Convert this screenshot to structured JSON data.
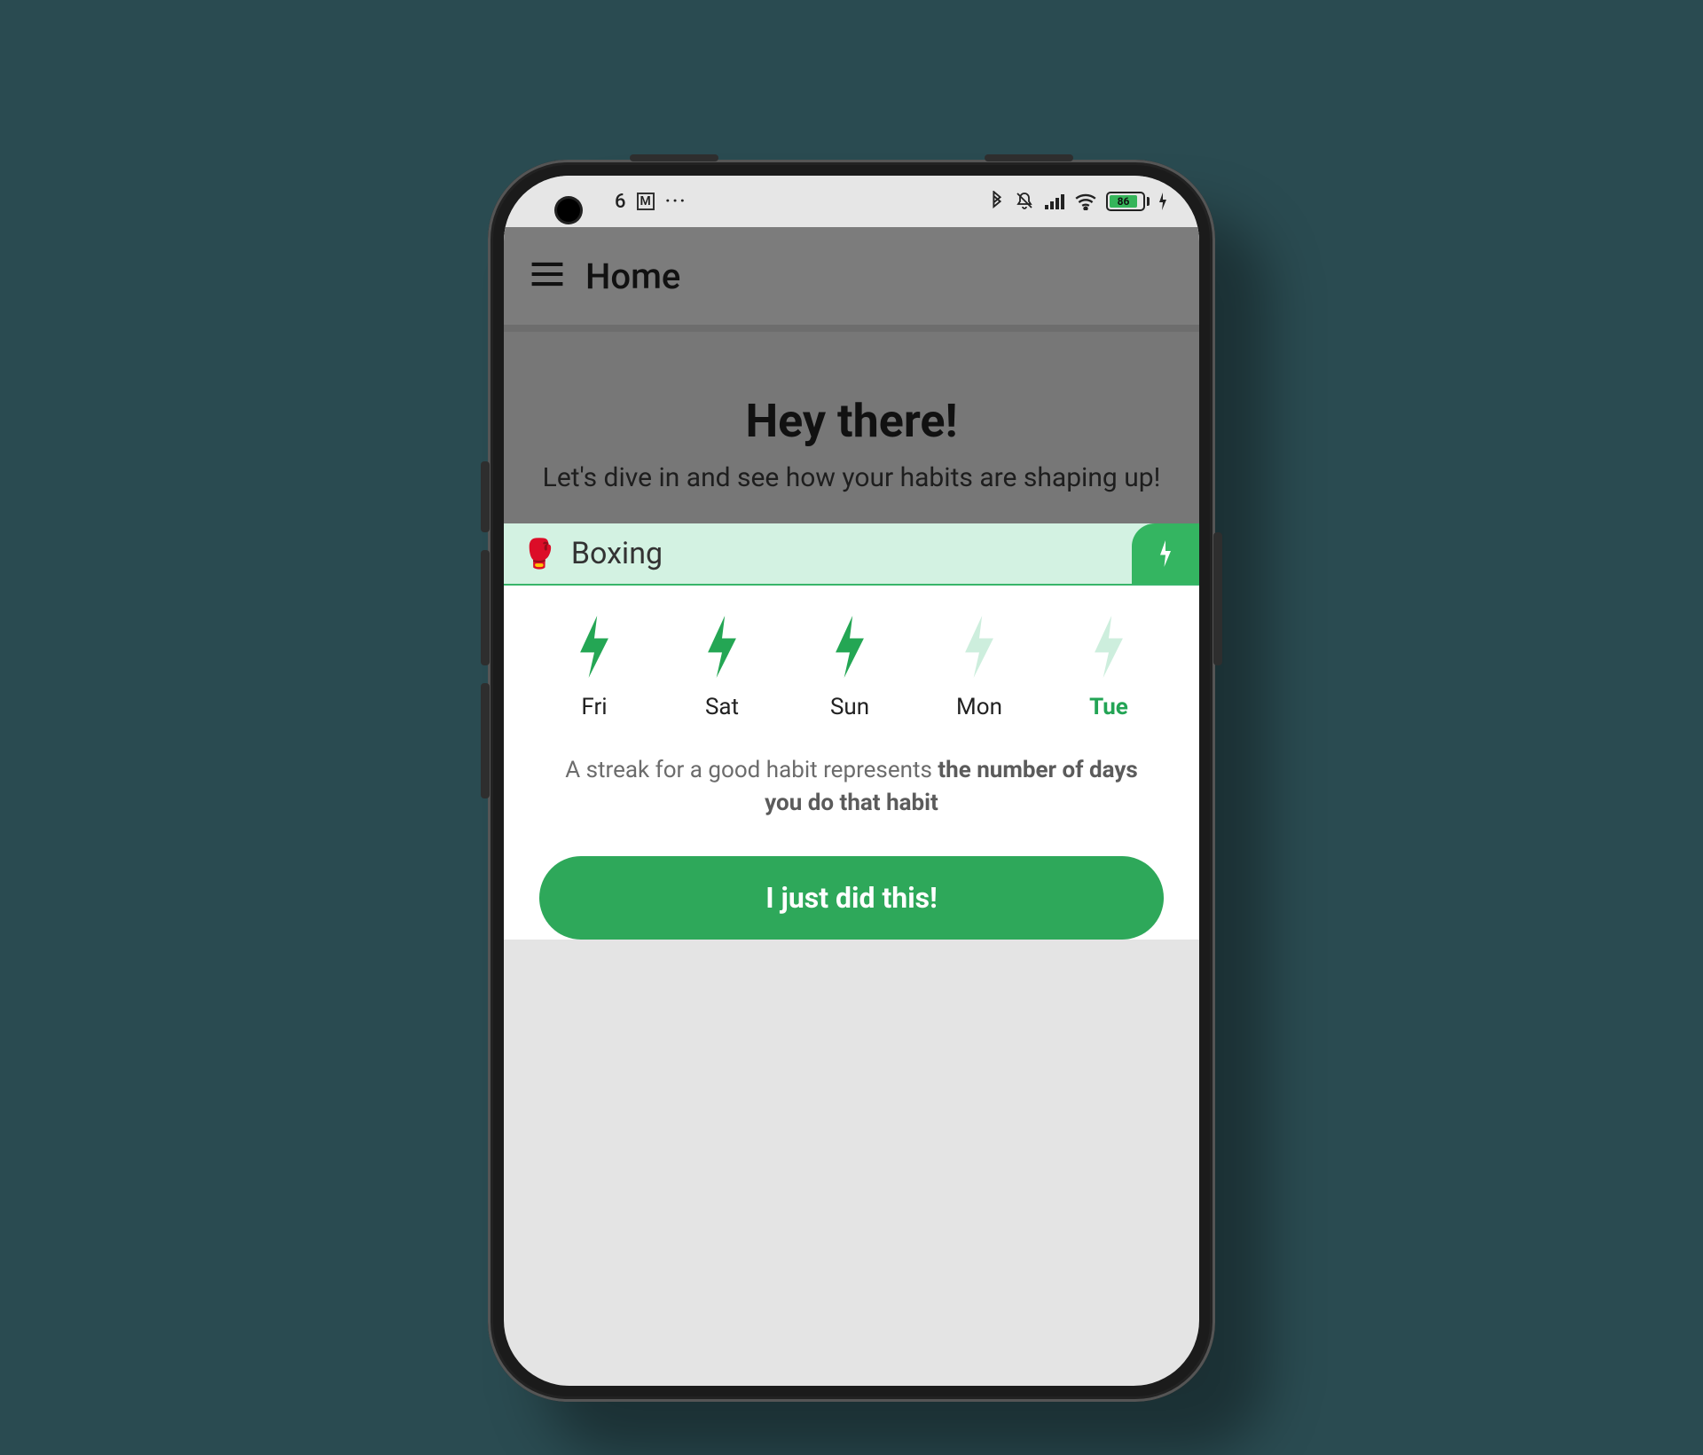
{
  "status": {
    "time_partial": "6",
    "gmail_icon": "M",
    "battery_percent": "86"
  },
  "header": {
    "title": "Home"
  },
  "greeting": {
    "heading": "Hey there!",
    "sub": "Let's dive in and see how your habits are shaping up!"
  },
  "habit": {
    "emoji": "🥊",
    "name": "Boxing"
  },
  "streak": {
    "days": [
      {
        "label": "Fri",
        "done": true,
        "current": false
      },
      {
        "label": "Sat",
        "done": true,
        "current": false
      },
      {
        "label": "Sun",
        "done": true,
        "current": false
      },
      {
        "label": "Mon",
        "done": false,
        "current": false
      },
      {
        "label": "Tue",
        "done": false,
        "current": true
      }
    ],
    "info_pre": "A streak for a good habit represents ",
    "info_bold": "the number of days you do that habit"
  },
  "action": {
    "label": "I just did this!"
  },
  "colors": {
    "accent": "#2ea85a",
    "bolt_done": "#24a654",
    "bolt_undone": "#cdeedd"
  }
}
